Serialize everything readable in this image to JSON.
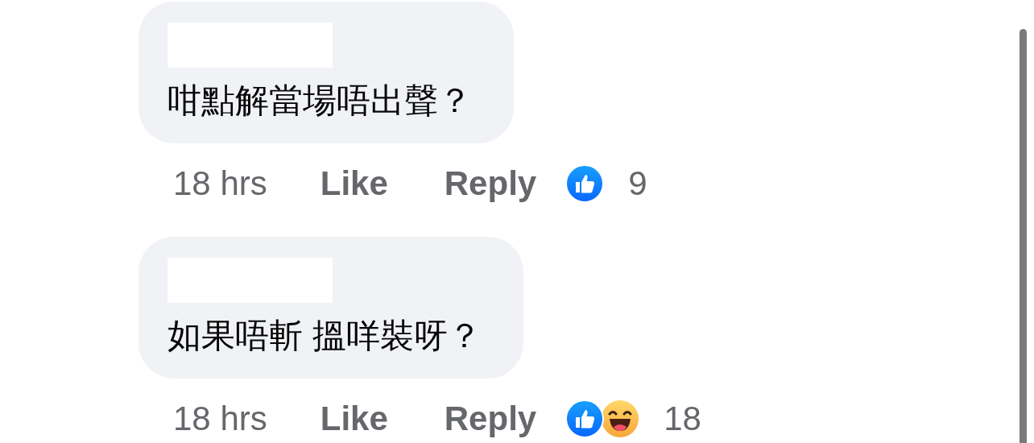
{
  "comments": [
    {
      "author_redacted": true,
      "text": "咁點解當場唔出聲？",
      "time": "18 hrs",
      "actions": [
        "Like",
        "Reply"
      ],
      "reactions": [
        {
          "kind": "like"
        }
      ],
      "reaction_count": "9"
    },
    {
      "author_redacted": true,
      "text": "如果唔斬 搵咩裝呀？",
      "time": "18 hrs",
      "actions": [
        "Like",
        "Reply"
      ],
      "reactions": [
        {
          "kind": "like"
        },
        {
          "kind": "haha"
        }
      ],
      "reaction_count": "18"
    }
  ]
}
